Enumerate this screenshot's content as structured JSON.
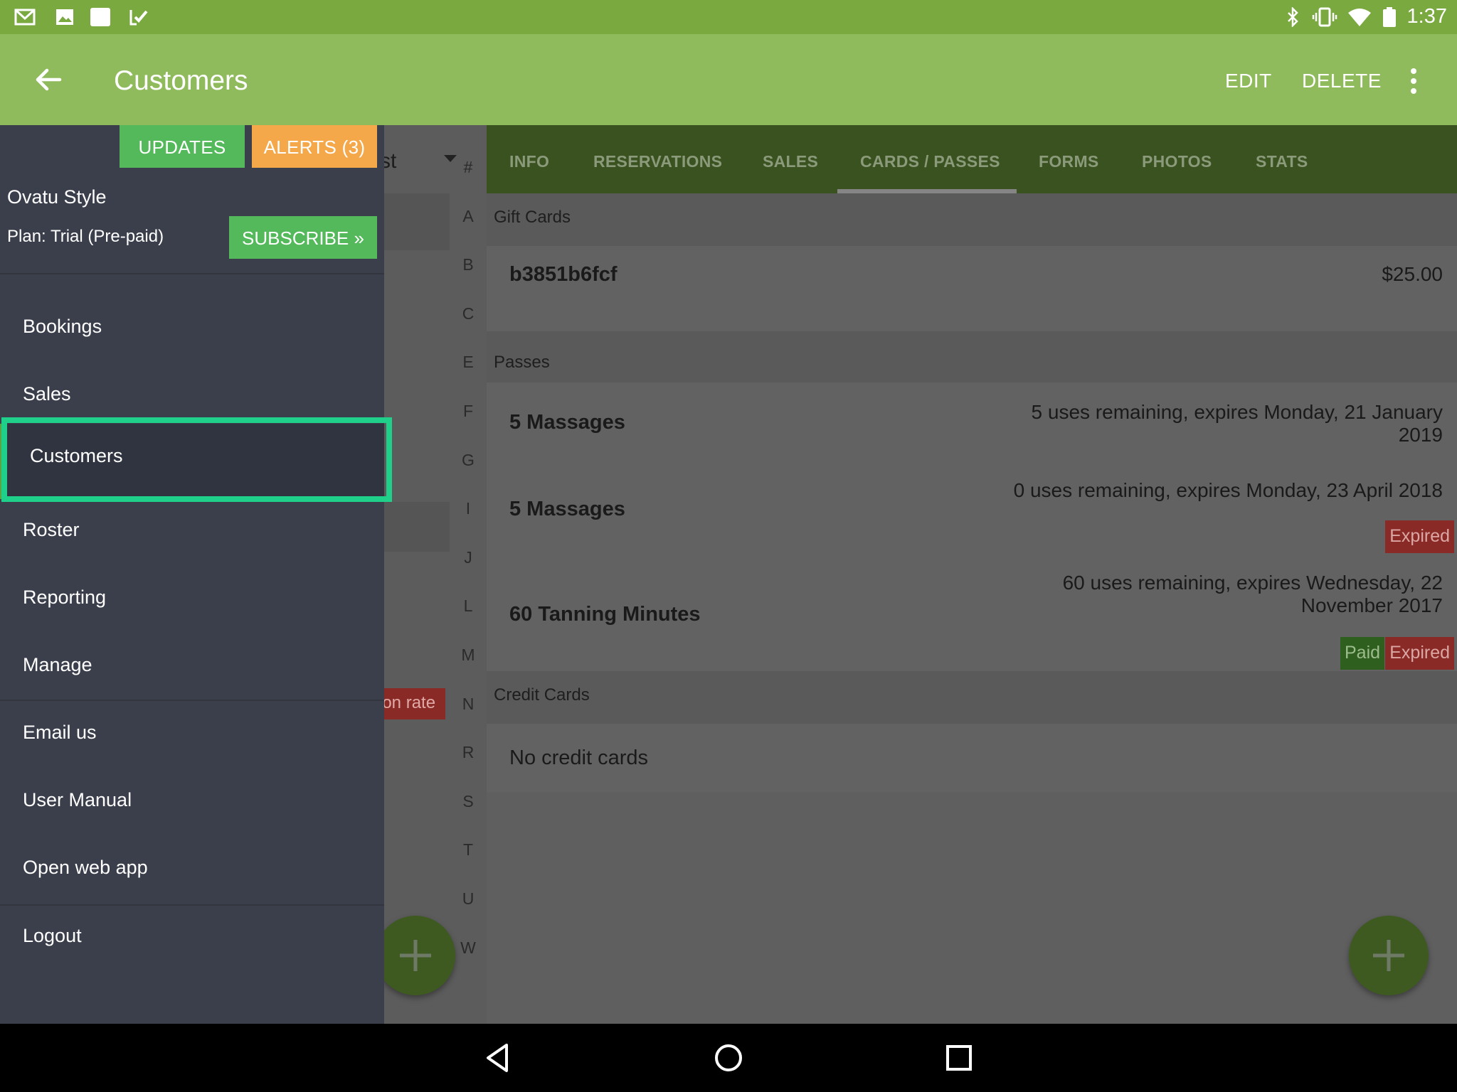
{
  "status_bar": {
    "time": "1:37",
    "left_icons": [
      "gmail-icon",
      "photos-icon",
      "square-app-icon",
      "tasks-check-icon"
    ],
    "right_icons": [
      "bluetooth-icon",
      "vibrate-icon",
      "wifi-icon",
      "battery-icon"
    ]
  },
  "app_bar": {
    "title": "Customers",
    "edit_label": "EDIT",
    "delete_label": "DELETE"
  },
  "drawer": {
    "updates_label": "UPDATES",
    "alerts_label": "ALERTS (3)",
    "business_name": "Ovatu Style",
    "plan": "Plan: Trial (Pre-paid)",
    "subscribe_label": "SUBSCRIBE »",
    "items": [
      {
        "label": "Bookings"
      },
      {
        "label": "Sales"
      },
      {
        "label": "Customers"
      },
      {
        "label": "Roster"
      },
      {
        "label": "Reporting"
      },
      {
        "label": "Manage"
      },
      {
        "label": "Email us"
      },
      {
        "label": "User Manual"
      },
      {
        "label": "Open web app"
      },
      {
        "label": "Logout"
      }
    ],
    "selected": "Customers",
    "highlight_color": "#1fd08a"
  },
  "customer_list": {
    "header_fragment": "st",
    "rate_badge_fragment": "ion rate",
    "index_letters": [
      "#",
      "A",
      "B",
      "C",
      "E",
      "F",
      "G",
      "I",
      "J",
      "L",
      "M",
      "N",
      "R",
      "S",
      "T",
      "U",
      "W"
    ]
  },
  "tabs": [
    {
      "label": "INFO"
    },
    {
      "label": "RESERVATIONS"
    },
    {
      "label": "SALES"
    },
    {
      "label": "CARDS / PASSES"
    },
    {
      "label": "FORMS"
    },
    {
      "label": "PHOTOS"
    },
    {
      "label": "STATS"
    }
  ],
  "active_tab": "CARDS / PASSES",
  "gift_cards": {
    "header": "Gift Cards",
    "items": [
      {
        "code": "b3851b6fcf",
        "amount": "$25.00"
      }
    ]
  },
  "passes": {
    "header": "Passes",
    "items": [
      {
        "name": "5 Massages",
        "detail_line1": "5 uses remaining, expires Monday, 21 January",
        "detail_line2": "2019",
        "badges": []
      },
      {
        "name": "5 Massages",
        "detail_line1": "0 uses remaining, expires Monday, 23 April 2018",
        "detail_line2": "",
        "badges": [
          "Expired"
        ]
      },
      {
        "name": "60 Tanning Minutes",
        "detail_line1": "60 uses remaining, expires Wednesday, 22",
        "detail_line2": "November 2017",
        "badges": [
          "Paid",
          "Expired"
        ]
      }
    ]
  },
  "credit_cards": {
    "header": "Credit Cards",
    "empty_text": "No credit cards"
  },
  "colors": {
    "status_bar": "#79a93f",
    "app_bar": "#8fbb5d",
    "tabs_bg": "#3a521f",
    "drawer_bg": "#3b3f4c",
    "updates": "#53b95a",
    "alerts": "#f5a84a",
    "expired": "#8a2a27",
    "paid": "#2f5f1f"
  }
}
